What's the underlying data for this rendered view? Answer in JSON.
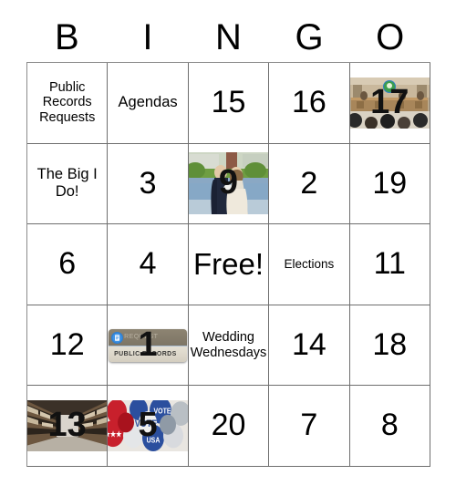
{
  "card": {
    "header_letters": [
      "B",
      "I",
      "N",
      "G",
      "O"
    ],
    "free_space_label": "Free!",
    "cells": [
      [
        {
          "name": "public-records-requests",
          "type": "text",
          "text": "Public Records Requests",
          "size": "small"
        },
        {
          "name": "agendas",
          "type": "text",
          "text": "Agendas",
          "size": "medium"
        },
        {
          "name": "number-15",
          "type": "number",
          "text": "15",
          "size": "number"
        },
        {
          "name": "number-16",
          "type": "number",
          "text": "16",
          "size": "number"
        },
        {
          "name": "council-chamber-photo-17",
          "type": "photo",
          "text": "17",
          "photo": "council-chamber",
          "alt": "City council chamber with dais and audience"
        }
      ],
      [
        {
          "name": "the-big-i-do",
          "type": "text",
          "text": "The Big I Do!",
          "size": "medium"
        },
        {
          "name": "number-3",
          "type": "number",
          "text": "3",
          "size": "number"
        },
        {
          "name": "wedding-couple-photo-9",
          "type": "photo",
          "text": "9",
          "photo": "wedding-couple",
          "alt": "Wedding couple by an outdoor fountain"
        },
        {
          "name": "number-2",
          "type": "number",
          "text": "2",
          "size": "number"
        },
        {
          "name": "number-19",
          "type": "number",
          "text": "19",
          "size": "number"
        }
      ],
      [
        {
          "name": "number-6",
          "type": "number",
          "text": "6",
          "size": "number"
        },
        {
          "name": "number-4",
          "type": "number",
          "text": "4",
          "size": "number"
        },
        {
          "name": "free-space",
          "type": "text",
          "text": "Free!",
          "size": "free"
        },
        {
          "name": "elections",
          "type": "text",
          "text": "Elections",
          "size": "tiny"
        },
        {
          "name": "number-11",
          "type": "number",
          "text": "11",
          "size": "number"
        }
      ],
      [
        {
          "name": "number-12",
          "type": "number",
          "text": "12",
          "size": "number"
        },
        {
          "name": "request-public-records-badge-1",
          "type": "badge",
          "text": "1",
          "badge_top": "REQUEST",
          "badge_bottom": "PUBLIC RECORDS"
        },
        {
          "name": "wedding-wednesdays",
          "type": "text",
          "text": "Wedding Wednesdays",
          "size": "small"
        },
        {
          "name": "number-14",
          "type": "number",
          "text": "14",
          "size": "number"
        },
        {
          "name": "number-18",
          "type": "number",
          "text": "18",
          "size": "number"
        }
      ],
      [
        {
          "name": "records-archive-photo-13",
          "type": "photo",
          "text": "13",
          "photo": "records-archive",
          "alt": "Archive warehouse aisle lined with record boxes"
        },
        {
          "name": "vote-buttons-photo-5",
          "type": "photo",
          "text": "5",
          "photo": "vote-buttons",
          "alt": "Pile of red white and blue VOTE campaign pins"
        },
        {
          "name": "number-20",
          "type": "number",
          "text": "20",
          "size": "number"
        },
        {
          "name": "number-7",
          "type": "number",
          "text": "7",
          "size": "number"
        },
        {
          "name": "number-8",
          "type": "number",
          "text": "8",
          "size": "number"
        }
      ]
    ]
  },
  "colors": {
    "page_background": "#ffffff",
    "grid_line": "#6e6e6e",
    "text": "#000000",
    "badge_top": "#8d8472",
    "badge_bottom": "#e6e1d5",
    "vote_red": "#c8202c",
    "vote_blue": "#2b4f9e"
  }
}
